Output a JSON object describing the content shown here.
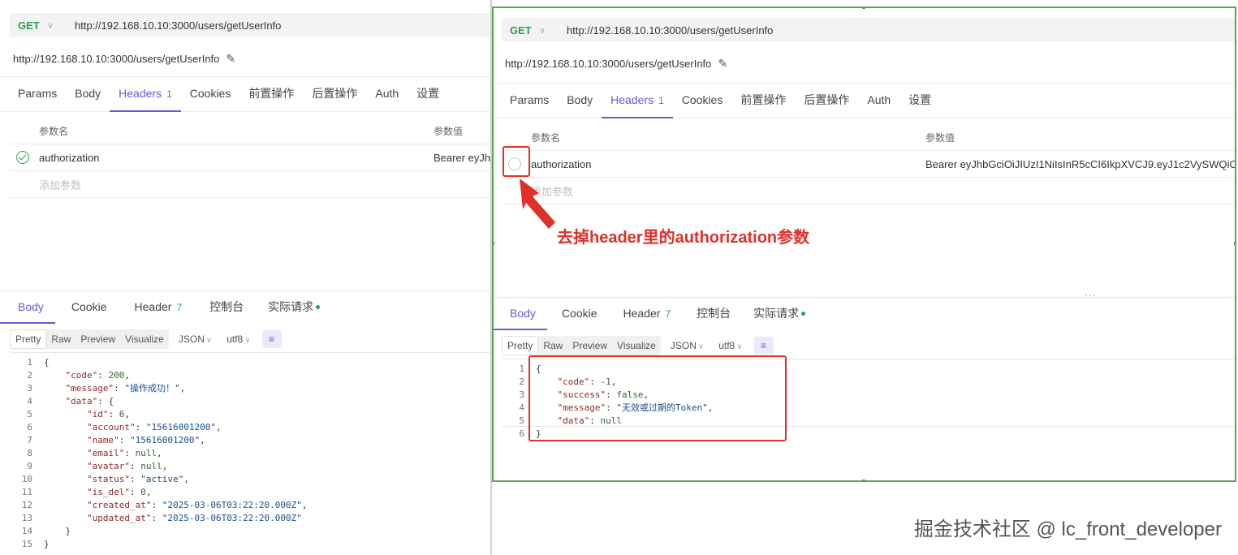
{
  "left": {
    "method": "GET",
    "url": "http://192.168.10.10:3000/users/getUserInfo",
    "url_display": "http://192.168.10.10:3000/users/getUserInfo",
    "tabs": [
      {
        "label": "Params"
      },
      {
        "label": "Body"
      },
      {
        "label": "Headers",
        "count": "1"
      },
      {
        "label": "Cookies"
      },
      {
        "label": "前置操作"
      },
      {
        "label": "后置操作"
      },
      {
        "label": "Auth"
      },
      {
        "label": "设置"
      }
    ],
    "table": {
      "col_name": "参数名",
      "col_value": "参数值",
      "row_key": "authorization",
      "row_value": "Bearer eyJh",
      "add_placeholder": "添加参数"
    },
    "resp_tabs": [
      {
        "label": "Body"
      },
      {
        "label": "Cookie"
      },
      {
        "label": "Header",
        "count": "7"
      },
      {
        "label": "控制台"
      },
      {
        "label": "实际请求"
      }
    ],
    "toolbar": {
      "views": [
        "Pretty",
        "Raw",
        "Preview",
        "Visualize"
      ],
      "format": "JSON",
      "encoding": "utf8"
    },
    "code_lines": [
      "{",
      "    \"code\": 200,",
      "    \"message\": \"操作成功！\",",
      "    \"data\": {",
      "        \"id\": 6,",
      "        \"account\": \"15616001200\",",
      "        \"name\": \"15616001200\",",
      "        \"email\": null,",
      "        \"avatar\": null,",
      "        \"status\": \"active\",",
      "        \"is_del\": 0,",
      "        \"created_at\": \"2025-03-06T03:22:20.000Z\",",
      "        \"updated_at\": \"2025-03-06T03:22:20.000Z\"",
      "    }",
      "}"
    ]
  },
  "right": {
    "method": "GET",
    "url": "http://192.168.10.10:3000/users/getUserInfo",
    "url_display": "http://192.168.10.10:3000/users/getUserInfo",
    "tabs": [
      {
        "label": "Params"
      },
      {
        "label": "Body"
      },
      {
        "label": "Headers",
        "count": "1"
      },
      {
        "label": "Cookies"
      },
      {
        "label": "前置操作"
      },
      {
        "label": "后置操作"
      },
      {
        "label": "Auth"
      },
      {
        "label": "设置"
      }
    ],
    "table": {
      "col_name": "参数名",
      "col_value": "参数值",
      "row_key": "authorization",
      "row_value": "Bearer eyJhbGciOiJIUzI1NiIsInR5cCI6IkpXVCJ9.eyJ1c2VySWQiO",
      "add_placeholder": "添加参数"
    },
    "resp_tabs": [
      {
        "label": "Body"
      },
      {
        "label": "Cookie"
      },
      {
        "label": "Header",
        "count": "7"
      },
      {
        "label": "控制台"
      },
      {
        "label": "实际请求"
      }
    ],
    "toolbar": {
      "views": [
        "Pretty",
        "Raw",
        "Preview",
        "Visualize"
      ],
      "format": "JSON",
      "encoding": "utf8"
    },
    "code_lines": [
      "{",
      "    \"code\": -1,",
      "    \"success\": false,",
      "    \"message\": \"无效或过期的Token\",",
      "    \"data\": null",
      "}"
    ],
    "annotation": "去掉header里的authorization参数"
  },
  "watermark": "掘金技术社区 @ lc_front_developer",
  "colors": {
    "accent": "#6a5acd",
    "method_green": "#2e9e4f",
    "annotation_red": "#e0302a",
    "selection_border": "#59a84b"
  }
}
